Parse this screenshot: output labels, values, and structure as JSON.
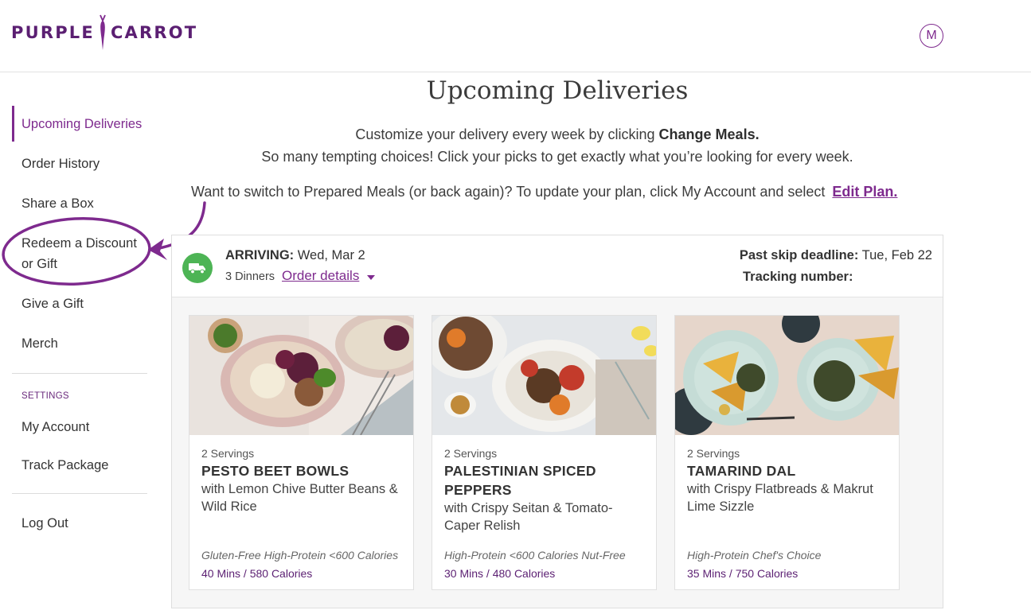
{
  "brand": {
    "word1": "PURPLE",
    "word2": "CARROT",
    "accent_color": "#7e2a8e",
    "dark_color": "#5b1f72"
  },
  "user": {
    "avatar_letter": "M"
  },
  "sidebar": {
    "items": [
      {
        "label": "Upcoming Deliveries",
        "active": true
      },
      {
        "label": "Order History"
      },
      {
        "label": "Share a Box"
      },
      {
        "label_line1": "Redeem a Discount",
        "label_line2": "or Gift"
      },
      {
        "label": "Give a Gift"
      },
      {
        "label": "Merch"
      }
    ],
    "settings_heading": "SETTINGS",
    "settings_items": [
      {
        "label": "My Account"
      },
      {
        "label": "Track Package"
      }
    ],
    "logout": "Log Out"
  },
  "main": {
    "title": "Upcoming Deliveries",
    "intro_line1": "Customize your delivery every week by clicking ",
    "intro_line1_bold": "Change Meals.",
    "intro_line2": "So many tempting choices! Click your picks to  get exactly what you’re looking for every week.",
    "switch_text": "Want to switch to Prepared Meals (or back again)? To update your plan, click My Account and select ",
    "switch_link": "Edit Plan."
  },
  "delivery": {
    "arriving_label": "ARRIVING:",
    "arriving_date": " Wed, Mar 2",
    "dinners": "3 Dinners",
    "order_details": "Order details",
    "skip_label": "Past skip deadline:",
    "skip_date": " Tue, Feb 22",
    "tracking_label": "Tracking number:",
    "status_color": "#4db455"
  },
  "meals": [
    {
      "servings": "2 Servings",
      "name": "PESTO BEET BOWLS",
      "subtitle": "with Lemon Chive Butter Beans & Wild Rice",
      "tags": "Gluten-Free High-Protein <600 Calories",
      "time": "40 Mins / 580 Calories"
    },
    {
      "servings": "2 Servings",
      "name": "PALESTINIAN SPICED PEPPERS",
      "subtitle": "with Crispy Seitan & Tomato-Caper Relish",
      "tags": "High-Protein <600 Calories Nut-Free",
      "time": "30 Mins / 480 Calories"
    },
    {
      "servings": "2 Servings",
      "name": "TAMARIND DAL",
      "subtitle": "with Crispy Flatbreads & Makrut Lime Sizzle",
      "tags": "High-Protein Chef's Choice",
      "time": "35 Mins / 750 Calories"
    }
  ]
}
